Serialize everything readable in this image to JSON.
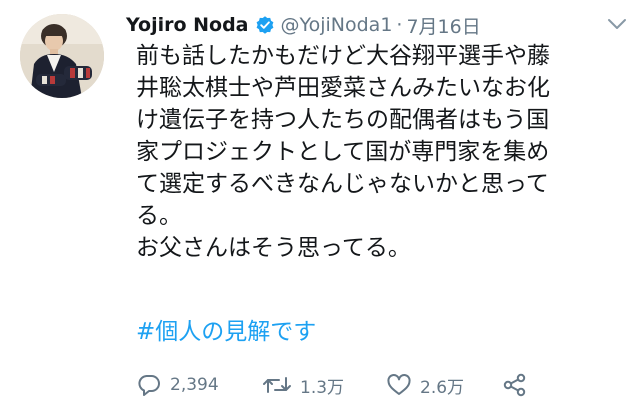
{
  "tweet": {
    "author": {
      "name": "Yojiro Noda",
      "handle": "@YojiNoda1"
    },
    "separator": "·",
    "date": "7月16日",
    "body": "前も話したかもだけど大谷翔平選手や藤\n井聡太棋士や芦田愛菜さんみたいなお化\nけ遺伝子を持つ人たちの配偶者はもう国\n家プロジェクトとして国が専門家を集め\nて選定するべきなんじゃないかと思って\nる。\nお父さんはそう思ってる。",
    "hashtag": "#個人の見解です"
  },
  "actions": {
    "reply_count": "2,394",
    "retweet_count": "1.3万",
    "like_count": "2.6万"
  },
  "icons": {
    "verified": "verified-badge-icon",
    "caret": "chevron-down-icon",
    "reply": "reply-bubble-icon",
    "retweet": "retweet-icon",
    "like": "heart-icon",
    "share": "share-icon"
  },
  "colors": {
    "text": "#14171a",
    "secondary": "#657786",
    "accent": "#1da1f2"
  }
}
